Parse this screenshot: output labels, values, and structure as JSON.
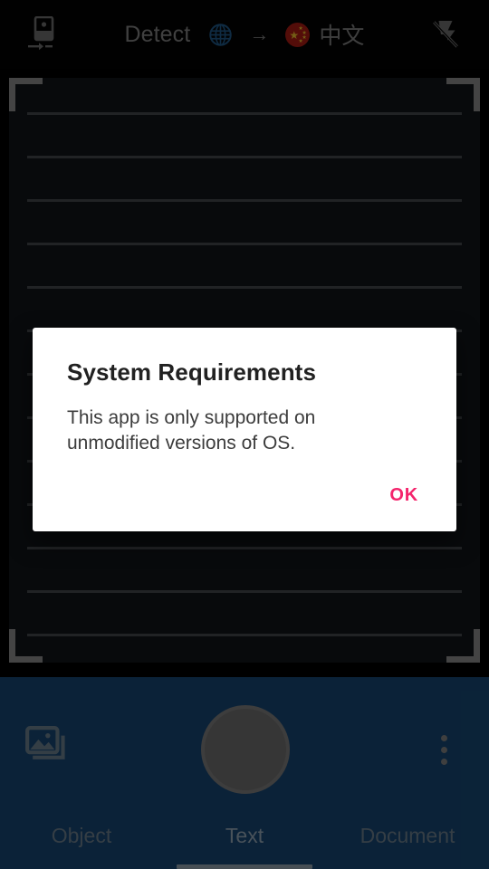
{
  "topbar": {
    "image_translate_icon": "image-to-text-icon",
    "source_language": "Detect",
    "source_language_icon": "globe-icon",
    "direction_arrow": "→",
    "target_flag_icon": "flag-china-icon",
    "target_language": "中文",
    "flash_icon": "flash-off-icon"
  },
  "viewfinder": {
    "frame_icon": "viewfinder-corners",
    "line_count": 11
  },
  "dialog": {
    "title": "System Requirements",
    "message": "This app is only supported on unmodified versions of OS.",
    "ok_label": "OK",
    "accent_color": "#f4246c"
  },
  "bottombar": {
    "background_color": "#133c61",
    "gallery_icon": "photo-library-icon",
    "shutter_icon": "shutter-button",
    "more_icon": "overflow-menu-icon",
    "tabs": [
      {
        "label": "Object",
        "active": false
      },
      {
        "label": "Text",
        "active": true
      },
      {
        "label": "Document",
        "active": false
      }
    ]
  }
}
